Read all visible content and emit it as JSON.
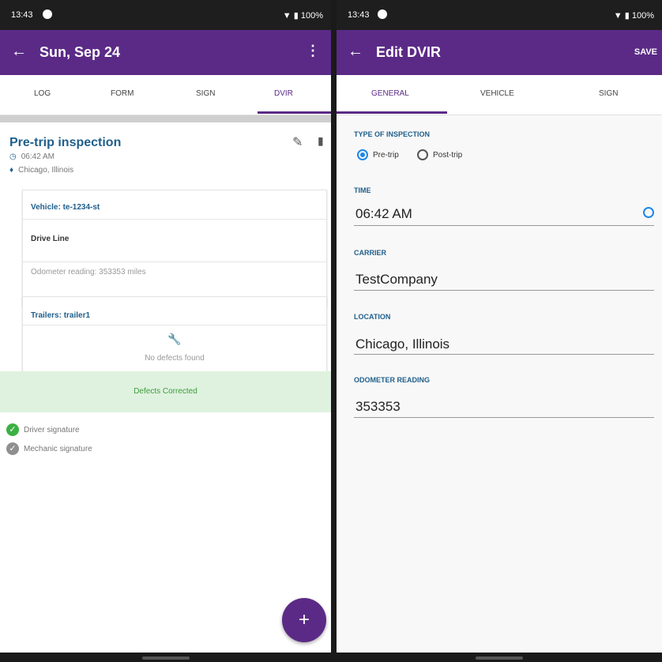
{
  "left": {
    "status": {
      "time": "13:43",
      "battery": "100%"
    },
    "appbar": {
      "title": "Sun, Sep 24"
    },
    "tabs": [
      "LOG",
      "FORM",
      "SIGN",
      "DVIR"
    ],
    "inspection": {
      "title": "Pre-trip inspection",
      "time": "06:42 AM",
      "location": "Chicago, Illinois"
    },
    "vehicle_card": {
      "vehicle": "Vehicle: te-1234-st",
      "defect": "Drive Line",
      "odometer": "Odometer reading: 353353 miles"
    },
    "trailer_card": {
      "trailers": "Trailers: trailer1",
      "no_defects": "No defects found"
    },
    "defects_status": "Defects Corrected",
    "signatures": [
      {
        "label": "Driver signature",
        "status": "signed",
        "color": "#3cb043"
      },
      {
        "label": "Mechanic signature",
        "status": "pending",
        "color": "#8f8f8f"
      }
    ],
    "fab_label": "+"
  },
  "right": {
    "status": {
      "time": "13:43",
      "battery": "100%"
    },
    "appbar": {
      "title": "Edit DVIR",
      "save": "SAVE"
    },
    "tabs": [
      "GENERAL",
      "VEHICLE",
      "SIGN"
    ],
    "type_label": "TYPE OF INSPECTION",
    "options": [
      "Pre-trip",
      "Post-trip"
    ],
    "selected_option": "Pre-trip",
    "time_label": "TIME",
    "time_value": "06:42 AM",
    "carrier_label": "CARRIER",
    "carrier_value": "TestCompany",
    "location_label": "LOCATION",
    "location_value": "Chicago, Illinois",
    "odometer_label": "ODOMETER READING",
    "odometer_value": "353353"
  },
  "colors": {
    "primary": "#5b2a86",
    "accent_blue": "#1e88e5",
    "label_blue": "#1f5f8b",
    "green_band": "#dff2df"
  }
}
